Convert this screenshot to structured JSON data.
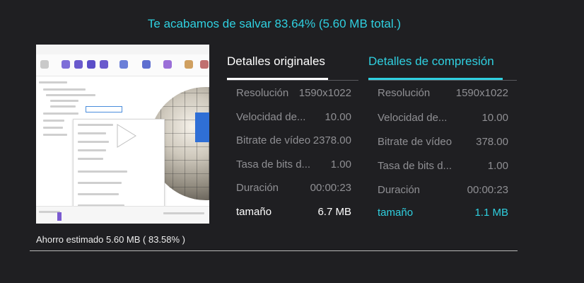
{
  "headline": "Te acabamos de salvar 83.64% (5.60 MB total.)",
  "preview": {
    "play_icon": "play-icon"
  },
  "savings_text": "Ahorro estimado 5.60 MB ( 83.58% )",
  "tabs": {
    "original": "Detalles originales",
    "compressed": "Detalles de compresión"
  },
  "original": [
    {
      "label": "Resolución",
      "value": "1590x1022"
    },
    {
      "label": "Velocidad de...",
      "value": "10.00"
    },
    {
      "label": "Bitrate de vídeo",
      "value": "2378.00"
    },
    {
      "label": "Tasa de bits d...",
      "value": "1.00"
    },
    {
      "label": "Duración",
      "value": "00:00:23"
    },
    {
      "label": "tamaño",
      "value": "6.7 MB"
    }
  ],
  "compressed": [
    {
      "label": "Resolución",
      "value": "1590x1022"
    },
    {
      "label": "Velocidad de...",
      "value": "10.00"
    },
    {
      "label": "Bitrate de vídeo",
      "value": "378.00"
    },
    {
      "label": "Tasa de bits d...",
      "value": "1.00"
    },
    {
      "label": "Duración",
      "value": "00:00:23"
    },
    {
      "label": "tamaño",
      "value": "1.1 MB"
    }
  ],
  "colors": {
    "accent": "#2fd0e0",
    "background": "#1f1f22",
    "muted_text": "#8f8f93"
  }
}
